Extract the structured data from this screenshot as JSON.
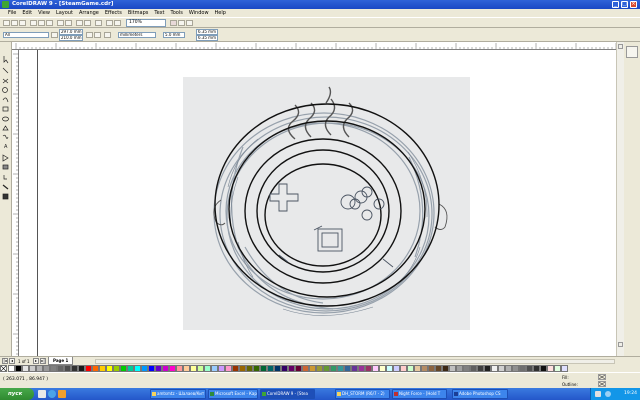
{
  "window": {
    "title": "CorelDRAW 9 - [SteamGame.cdr]"
  },
  "menu": [
    "File",
    "Edit",
    "View",
    "Layout",
    "Arrange",
    "Effects",
    "Bitmaps",
    "Text",
    "Tools",
    "Window",
    "Help"
  ],
  "toolbar": {
    "zoom": "170%"
  },
  "propertybar": {
    "object_select": "All",
    "x": "297.0 mm",
    "y": "210.0 mm",
    "units": "millimeters",
    "nudge": "5.0 mm",
    "dup_x": "6.35 mm",
    "dup_y": "6.35 mm"
  },
  "pagenav": {
    "page_count": "1 of 1",
    "page_tab": "Page 1"
  },
  "status": {
    "coords": "( 263.071 , 86.947 )",
    "fill_label": "Fill:",
    "outline_label": "Outline:"
  },
  "taskbar": {
    "start": "пуск",
    "items": [
      "amtsmtz - Шалаев/Кит",
      "Microsoft Excel - Кар",
      "CorelDRAW 9 - [Stea",
      "DH_STORM (R6/7 - 2)",
      "Night Force - [Hold T",
      "Adobe Photoshop CS"
    ],
    "clock": "19:24"
  },
  "colors": {
    "accent": "#2456c9",
    "palette": [
      "#ffffff",
      "#000000",
      "#e5e5e5",
      "#cccccc",
      "#b3b3b3",
      "#999999",
      "#808080",
      "#666666",
      "#4d4d4d",
      "#333333",
      "#1a1a1a",
      "#ff0000",
      "#ff6600",
      "#ffcc00",
      "#ffff00",
      "#99cc00",
      "#00cc00",
      "#00cc99",
      "#00ffff",
      "#0099ff",
      "#0000ff",
      "#6600cc",
      "#cc00cc",
      "#ff00cc",
      "#ff9999",
      "#ffcc99",
      "#ffff99",
      "#ccff99",
      "#99ffcc",
      "#99ccff",
      "#cc99ff",
      "#ff99cc",
      "#993300",
      "#996600",
      "#666600",
      "#336600",
      "#006633",
      "#006666",
      "#003366",
      "#330066",
      "#660066",
      "#660033",
      "#cc6633",
      "#cc9933",
      "#999933",
      "#669933",
      "#339966",
      "#339999",
      "#336699",
      "#663399",
      "#993399",
      "#993366",
      "#ffccff",
      "#ffffcc",
      "#ccffff",
      "#ccccff",
      "#ffcccc",
      "#ccffcc",
      "#e6c8a0",
      "#b48c64",
      "#8c6440",
      "#644628",
      "#3c2814",
      "#c0c0c0",
      "#a0a0a0",
      "#808080",
      "#606060",
      "#404040",
      "#202020",
      "#f0f0f0",
      "#d0d0d0",
      "#b0b0b0",
      "#909090",
      "#707070",
      "#505050",
      "#303030",
      "#101010",
      "#ffe0e0",
      "#e0ffe0",
      "#e0e0ff"
    ]
  }
}
